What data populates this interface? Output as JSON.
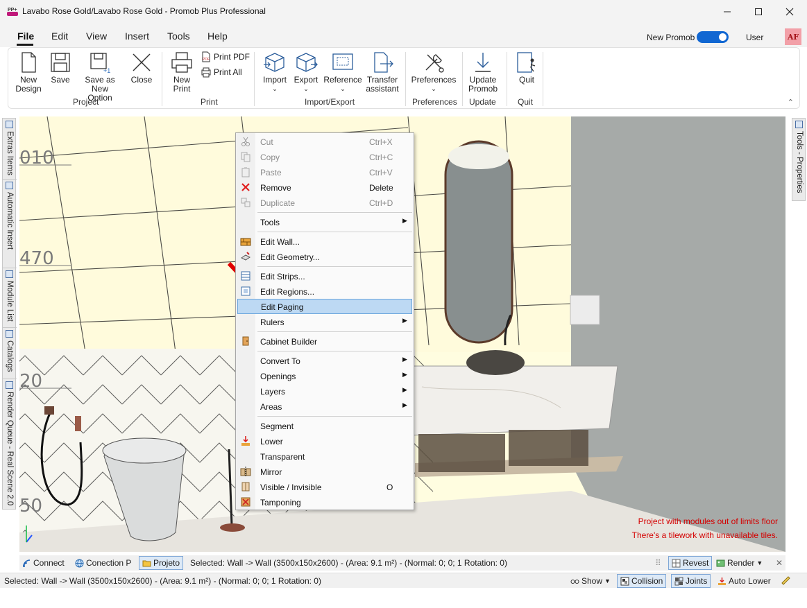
{
  "window": {
    "title": "Lavabo Rose Gold/Lavabo Rose Gold - Promob Plus Professional",
    "controls": [
      "minimize",
      "maximize",
      "close"
    ]
  },
  "menubar": {
    "items": [
      "File",
      "Edit",
      "View",
      "Insert",
      "Tools",
      "Help"
    ],
    "new_promob_label": "New Promob",
    "new_promob_on": true,
    "user_label": "User",
    "avatar_initials": "AF"
  },
  "ribbon": {
    "project": {
      "label": "Project",
      "new_design": "New\nDesign",
      "save": "Save",
      "save_as_new": "Save as New\nOption",
      "close": "Close"
    },
    "print": {
      "label": "Print",
      "new_print": "New\nPrint",
      "print_pdf": "Print PDF",
      "print_all": "Print All"
    },
    "import_export": {
      "label": "Import/Export",
      "import": "Import",
      "export": "Export",
      "reference": "Reference",
      "transfer": "Transfer\nassistant"
    },
    "preferences": {
      "label": "Preferences",
      "button": "Preferences"
    },
    "update": {
      "label": "Update",
      "button": "Update\nPromob"
    },
    "quit": {
      "label": "Quit",
      "button": "Quit"
    }
  },
  "left_tabs": [
    "Extras Items",
    "Automatic Insert",
    "Module List",
    "Catalogs",
    "Render Queue - Real Scene 2.0"
  ],
  "right_tabs": [
    "Tools - Properties"
  ],
  "viewport": {
    "dimension_labels": [
      "010",
      "470",
      "20",
      "50"
    ],
    "warnings": [
      "Project with modules out of limits floor",
      "There's a tilework with unavailable tiles."
    ]
  },
  "context_menu": {
    "items": [
      {
        "label": "Cut",
        "shortcut": "Ctrl+X",
        "disabled": true
      },
      {
        "label": "Copy",
        "shortcut": "Ctrl+C",
        "disabled": true
      },
      {
        "label": "Paste",
        "shortcut": "Ctrl+V",
        "disabled": true
      },
      {
        "label": "Remove",
        "shortcut": "Delete",
        "disabled": false
      },
      {
        "label": "Duplicate",
        "shortcut": "Ctrl+D",
        "disabled": true
      },
      {
        "label": "Tools",
        "submenu": true
      },
      {
        "label": "Edit Wall..."
      },
      {
        "label": "Edit Geometry..."
      },
      {
        "label": "Edit Strips..."
      },
      {
        "label": "Edit Regions..."
      },
      {
        "label": "Edit Paging",
        "highlighted": true
      },
      {
        "label": "Rulers",
        "submenu": true
      },
      {
        "label": "Cabinet Builder"
      },
      {
        "label": "Convert To",
        "submenu": true
      },
      {
        "label": "Openings",
        "submenu": true
      },
      {
        "label": "Layers",
        "submenu": true
      },
      {
        "label": "Areas",
        "submenu": true
      },
      {
        "label": "Segment"
      },
      {
        "label": "Lower"
      },
      {
        "label": "Transparent"
      },
      {
        "label": "Mirror"
      },
      {
        "label": "Visible / Invisible",
        "shortcut": "O"
      },
      {
        "label": "Tamponing"
      }
    ]
  },
  "status_bar_top": {
    "connect": "Connect",
    "conection": "Conection P",
    "projeto": "Projeto",
    "selected": "Selected: Wall -> Wall (3500x150x2600) - (Area: 9.1 m²) - (Normal: 0; 0; 1 Rotation: 0)",
    "revest": "Revest",
    "render": "Render"
  },
  "status_bar_bottom": {
    "selected": "Selected: Wall -> Wall (3500x150x2600) - (Area: 9.1 m²) - (Normal: 0; 0; 1 Rotation: 0)",
    "show": "Show",
    "collision": "Collision",
    "joints": "Joints",
    "auto_lower": "Auto Lower"
  },
  "colors": {
    "accent": "#1167d2",
    "highlight": "#bdd9f3",
    "warning": "#d40000",
    "avatar_bg": "#f2a0a8"
  }
}
